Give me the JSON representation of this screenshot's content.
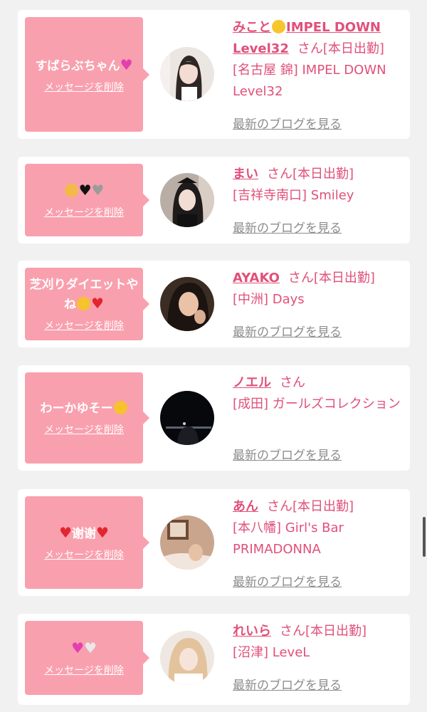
{
  "delete_label": "メッセージを削除",
  "san_label": "さん",
  "blog_label": "最新のブログを見る",
  "cards": [
    {
      "message": "すばらぶちゃん",
      "message_emoji": [
        "purple-heart"
      ],
      "name": "みこと",
      "name_emoji": "chick-icon",
      "name_suffix": "IMPEL DOWN Level32",
      "status": "[本日出勤]",
      "shop": "[名古屋 錦] IMPEL DOWN Level32"
    },
    {
      "message": "",
      "message_emoji": [
        "cat-face",
        "black-heart",
        "grey-heart"
      ],
      "name": "まい",
      "status": "[本日出勤]",
      "shop": "[吉祥寺南口] Smiley"
    },
    {
      "message": "芝刈りダイエットやね",
      "message_emoji": [
        "tears-of-joy",
        "red-heart"
      ],
      "name": "AYAKO",
      "status": "[本日出勤]",
      "shop": "[中洲] Days"
    },
    {
      "message": "わーかゆそー",
      "message_emoji": [
        "crying-face"
      ],
      "name": "ノエル",
      "status": "",
      "shop": "[成田] ガールズコレクション"
    },
    {
      "message": "谢谢",
      "message_emoji": [
        "red-heart",
        "red-heart"
      ],
      "name": "あん",
      "status": "[本日出勤]",
      "shop": "[本八幡] Girl's Bar PRIMADONNA"
    },
    {
      "message": "",
      "message_emoji": [
        "pink-heart",
        "white-heart"
      ],
      "name": "れいら",
      "status": "[本日出勤]",
      "shop": "[沼津] LeveL"
    }
  ]
}
